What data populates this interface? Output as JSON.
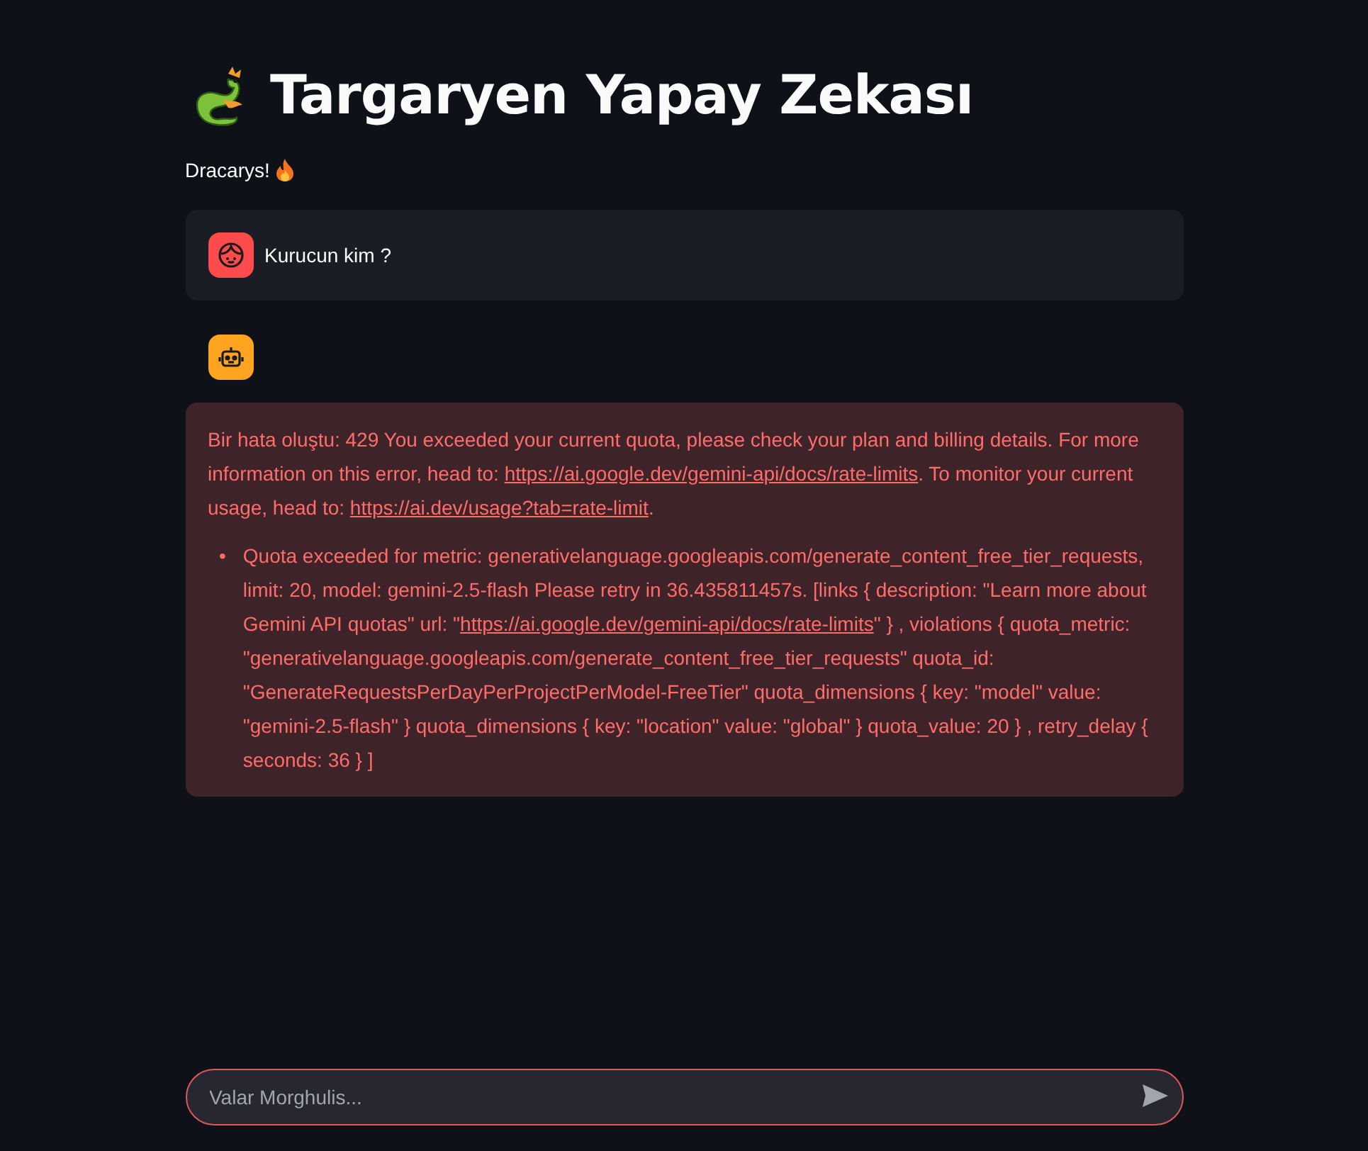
{
  "header": {
    "title": "Targaryen Yapay Zekası",
    "subtitle": "Dracarys!"
  },
  "messages": [
    {
      "kind": "user",
      "text": "Kurucun kim ?"
    },
    {
      "kind": "assistant",
      "error": {
        "parts": [
          {
            "kind": "text",
            "text": "Bir hata oluştu: 429 You exceeded your current quota, please check your plan and billing details. For more information on this error, head to: "
          },
          {
            "kind": "link",
            "text": "https://ai.google.dev/gemini-api/docs/rate-limits"
          },
          {
            "kind": "text",
            "text": ". To monitor your current usage, head to: "
          },
          {
            "kind": "link",
            "text": "https://ai.dev/usage?tab=rate-limit"
          },
          {
            "kind": "text",
            "text": "."
          }
        ],
        "bullets": [
          {
            "marker": "•",
            "parts": [
              {
                "kind": "text",
                "text": "Quota exceeded for metric: generativelanguage.googleapis.com/generate_content_free_tier_requests, limit: 20, model: gemini-2.5-flash Please retry in 36.435811457s. [links { description: \"Learn more about Gemini API quotas\" url: \""
              },
              {
                "kind": "link",
                "text": "https://ai.google.dev/gemini-api/docs/rate-limits"
              },
              {
                "kind": "text",
                "text": "\" } , violations { quota_metric: \"generativelanguage.googleapis.com/generate_content_free_tier_requests\" quota_id: \"GenerateRequestsPerDayPerProjectPerModel-FreeTier\" quota_dimensions { key: \"model\" value: \"gemini-2.5-flash\" } quota_dimensions { key: \"location\" value: \"global\" } quota_value: 20 } , retry_delay { seconds: 36 } ]"
              }
            ]
          }
        ]
      }
    }
  ],
  "chat_input": {
    "placeholder": "Valar Morghulis..."
  }
}
